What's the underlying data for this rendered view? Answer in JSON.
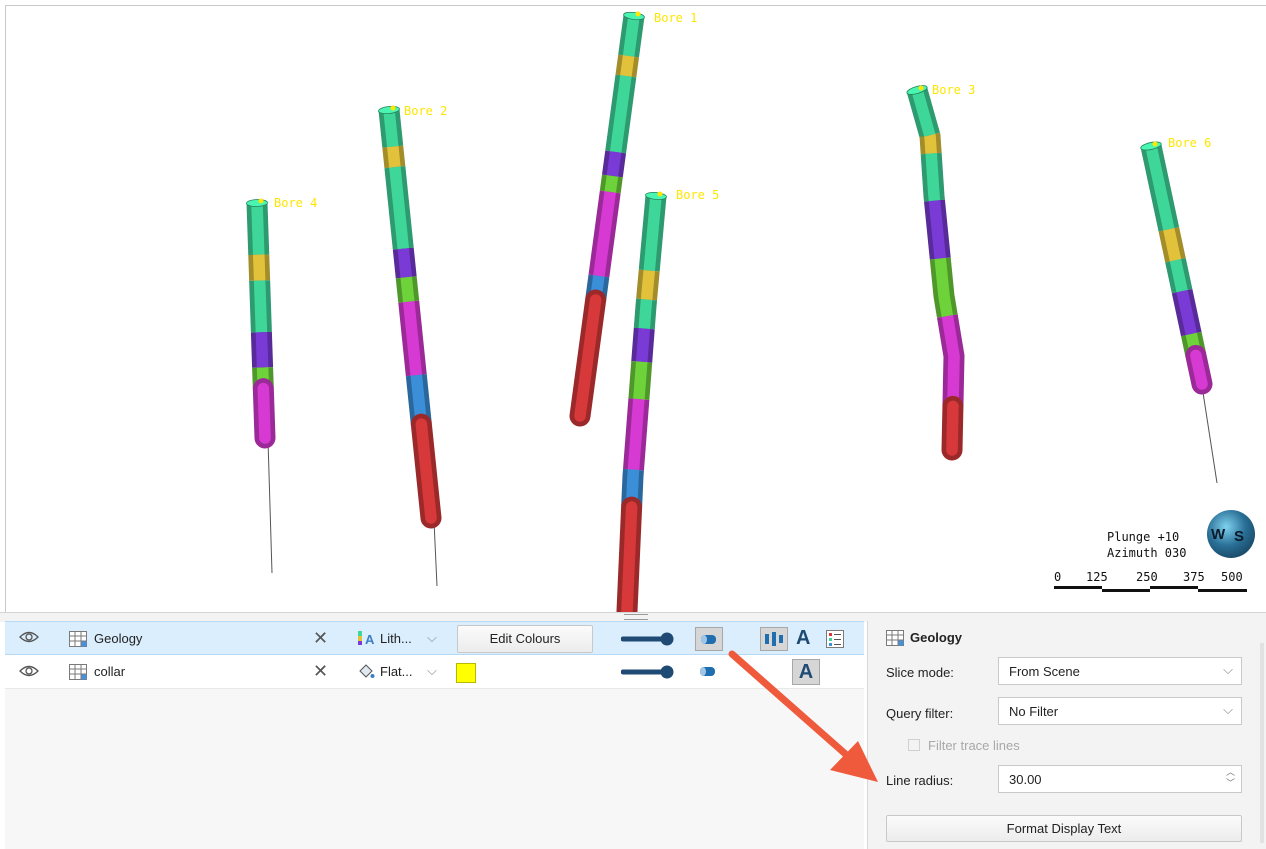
{
  "scene": {
    "bores": [
      {
        "label": "Bore 1"
      },
      {
        "label": "Bore 2"
      },
      {
        "label": "Bore 3"
      },
      {
        "label": "Bore 4"
      },
      {
        "label": "Bore 5"
      },
      {
        "label": "Bore 6"
      }
    ],
    "lithology_colors": {
      "teal": "#3fd69a",
      "yellow": "#e3c23b",
      "purple": "#7a3ad6",
      "green": "#6ed23a",
      "magenta": "#d73ad3",
      "blue": "#3b8fd8",
      "red": "#d7393a"
    },
    "plunge": "Plunge +10",
    "azimuth": "Azimuth 030",
    "scale_labels": [
      "0",
      "125",
      "250",
      "375",
      "500"
    ],
    "compass": {
      "letters": [
        "W",
        "S"
      ],
      "icon": "globe-compass-icon"
    }
  },
  "layers": [
    {
      "name": "Geology",
      "colour_mode": "Lith...",
      "button": "Edit Colours",
      "selected": true
    },
    {
      "name": "collar",
      "colour_mode": "Flat...",
      "swatch_color": "#ffff00",
      "selected": false
    }
  ],
  "properties": {
    "title": "Geology",
    "slice_mode_label": "Slice mode:",
    "slice_mode_value": "From Scene",
    "query_filter_label": "Query filter:",
    "query_filter_value": "No Filter",
    "filter_trace_label": "Filter trace lines",
    "line_radius_label": "Line radius:",
    "line_radius_value": "30.00",
    "format_button": "Format Display Text"
  },
  "annotation": {
    "arrow_color": "#f05a3c"
  }
}
